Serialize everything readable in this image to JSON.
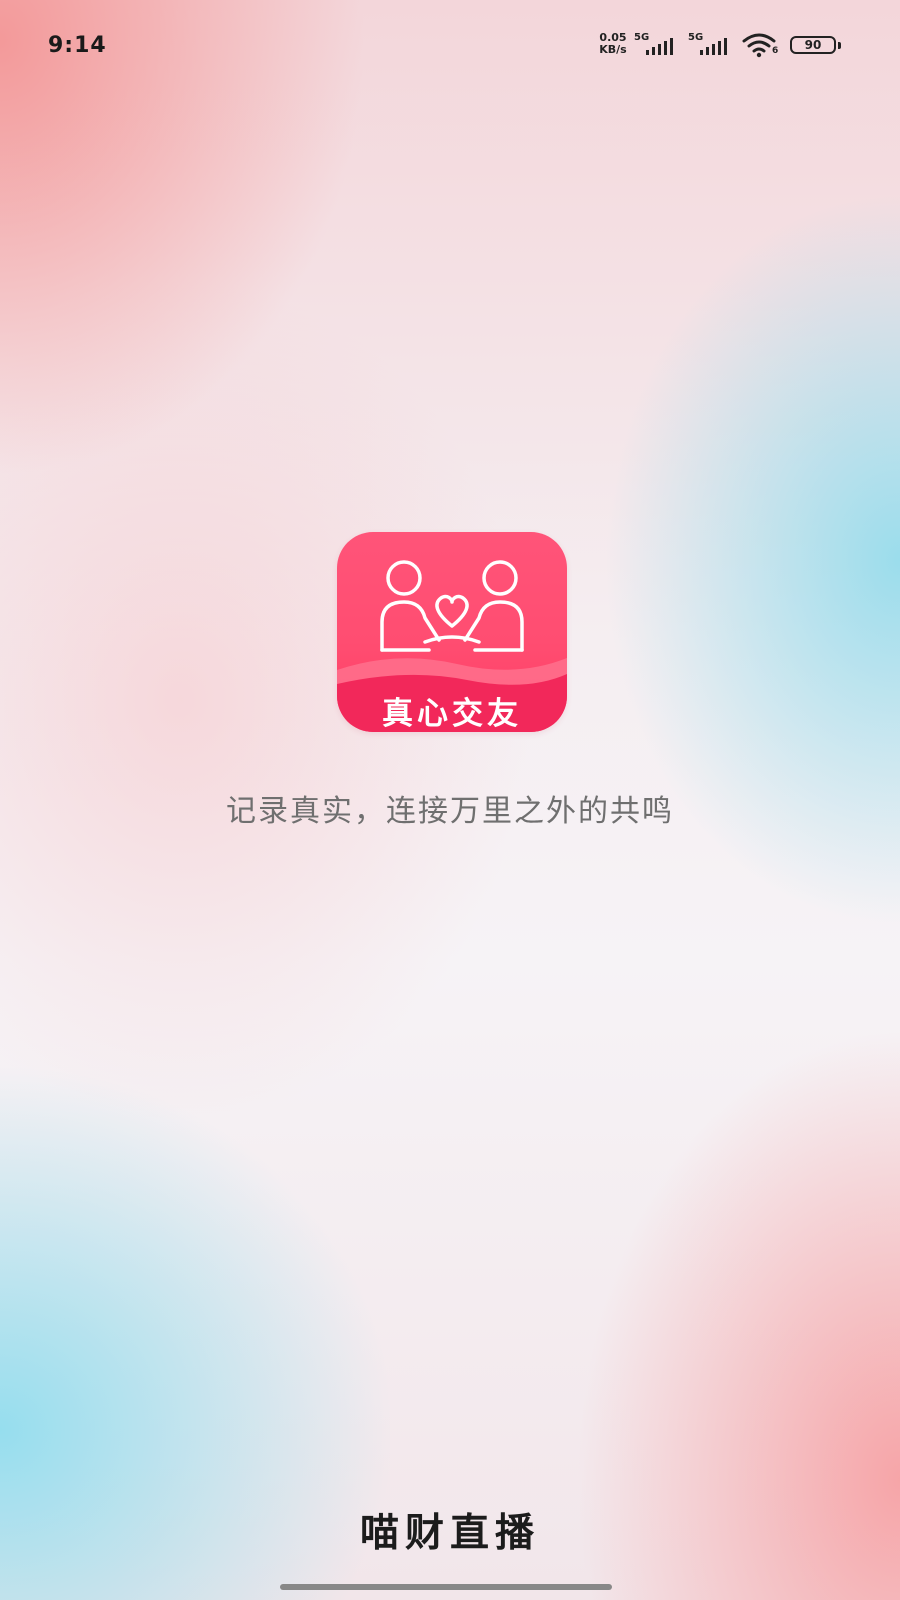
{
  "status_bar": {
    "time": "9:14",
    "net_speed_value": "0.05",
    "net_speed_unit": "KB/s",
    "sim1_label": "5G",
    "sim2_label": "5G",
    "wifi_label": "6",
    "battery_level": "90",
    "icons": [
      "signal-icon",
      "signal-icon",
      "wifi-icon",
      "battery-icon"
    ]
  },
  "splash": {
    "logo_text": "真心交友",
    "logo_icon": "couple-heart-icon",
    "tagline": "记录真实，连接万里之外的共鸣",
    "brand_name": "喵财直播"
  },
  "colors": {
    "logo_accent": "#ff4d71",
    "tagline_text": "#6f6f6f",
    "brand_text": "#1c1c1c"
  }
}
